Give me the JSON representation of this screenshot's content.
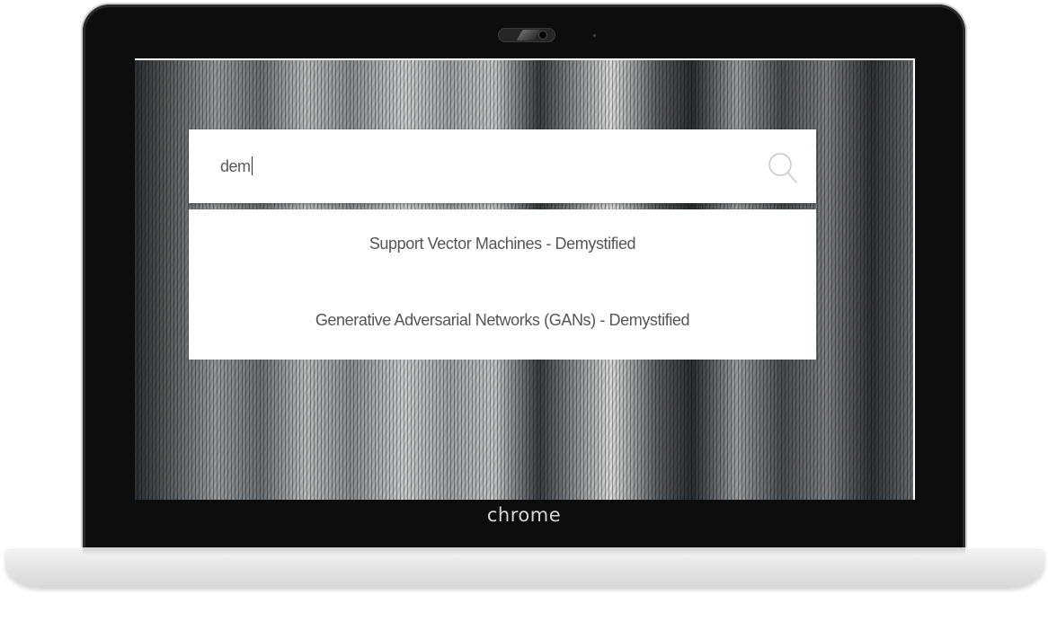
{
  "search": {
    "value": "dem"
  },
  "suggestions": [
    {
      "label": "Support Vector Machines - Demystified"
    },
    {
      "label": "Generative Adversarial Networks (GANs) - Demystified"
    }
  ],
  "device": {
    "brand": "chrome"
  },
  "icons": {
    "search": "search-icon"
  },
  "colors": {
    "panel_background": "#ffffff",
    "suggestion_text": "#555555",
    "bezel": "#0d0d0d"
  }
}
